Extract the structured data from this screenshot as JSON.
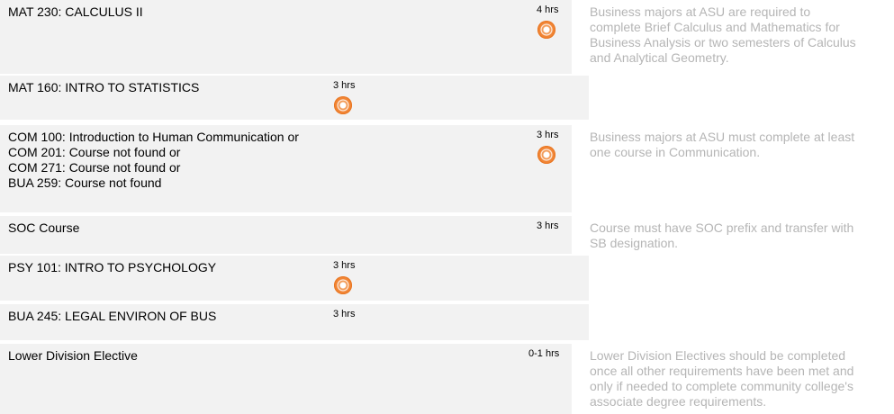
{
  "rows": [
    {
      "course": "MAT 230: CALCULUS II",
      "hours": "4 hrs",
      "note": "Business majors at ASU are required to\ncomplete Brief Calculus and Mathematics for\nBusiness Analysis or two semesters of Calculus\nand Analytical Geometry."
    },
    {
      "course": "MAT 160: INTRO TO STATISTICS",
      "hours": "3 hrs",
      "note": ""
    },
    {
      "course_lines": [
        "COM 100: Introduction to Human Communication or",
        "COM 201: Course not found or",
        "COM 271: Course not found or",
        "BUA 259: Course not found"
      ],
      "hours": "3 hrs",
      "note": "Business majors at ASU must complete at least\none course in Communication."
    },
    {
      "course": "SOC Course",
      "hours": "3 hrs",
      "note": "Course must have SOC prefix and transfer with\nSB designation."
    },
    {
      "course": "PSY 101: INTRO TO PSYCHOLOGY",
      "hours": "3 hrs",
      "note": ""
    },
    {
      "course": "BUA 245: LEGAL ENVIRON OF BUS",
      "hours": "3 hrs",
      "note": ""
    },
    {
      "course": "Lower Division Elective",
      "hours": "0-1 hrs",
      "note": "Lower Division Electives should be completed\nonce all other requirements have been met and\nonly if needed to complete community college's\nassociate degree requirements."
    }
  ],
  "icons": {
    "transfer_badge": "orange-target-icon"
  },
  "colors": {
    "row_bg": "#f2f2f2",
    "note_text": "#b5b5b5",
    "badge": "#f18535"
  }
}
